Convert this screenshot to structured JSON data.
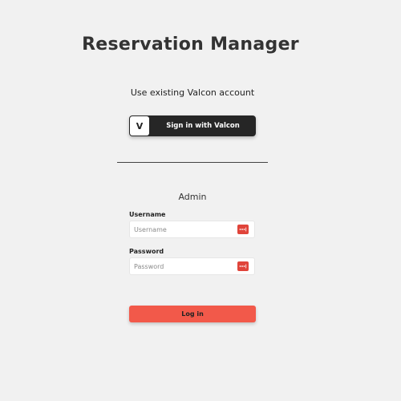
{
  "app": {
    "title": "Reservation Manager"
  },
  "sso": {
    "prompt": "Use existing Valcon account",
    "logo_letter": "V",
    "button_label": "Sign in with Valcon"
  },
  "admin": {
    "heading": "Admin",
    "username": {
      "label": "Username",
      "placeholder": "Username",
      "value": ""
    },
    "password": {
      "label": "Password",
      "placeholder": "Password",
      "value": ""
    },
    "login_label": "Log in"
  },
  "icons": {
    "sso_logo": "valcon-logo-icon",
    "field_icon": "password-manager-icon"
  },
  "colors": {
    "background": "#f1f1f1",
    "sso_button": "#262626",
    "accent": "#f2594a",
    "field_icon": "#e0443a"
  }
}
